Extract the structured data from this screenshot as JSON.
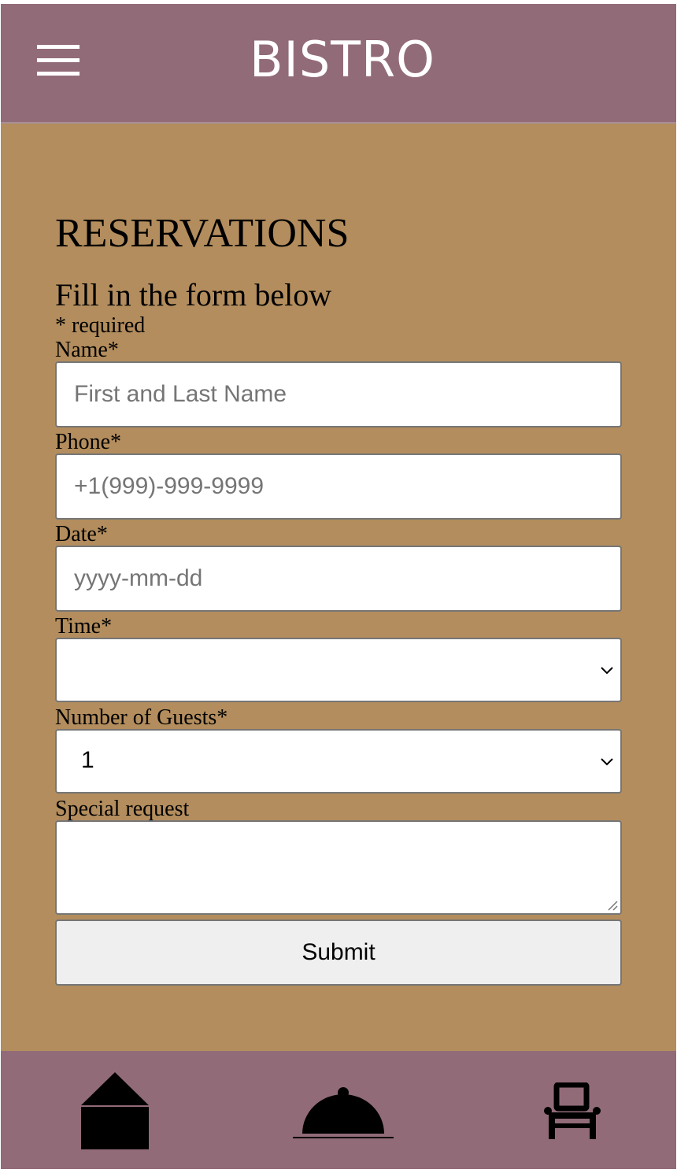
{
  "header": {
    "brand": "BISTRO",
    "menu_icon": "hamburger-menu-icon"
  },
  "form": {
    "title": "RESERVATIONS",
    "subtitle": "Fill in the form below",
    "required_note": "* required",
    "name": {
      "label": "Name*",
      "placeholder": "First and Last Name",
      "value": ""
    },
    "phone": {
      "label": "Phone*",
      "placeholder": "+1(999)-999-9999",
      "value": ""
    },
    "date": {
      "label": "Date*",
      "placeholder": "yyyy-mm-dd",
      "value": ""
    },
    "time": {
      "label": "Time*",
      "selected": ""
    },
    "guests": {
      "label": "Number of Guests*",
      "selected": "1"
    },
    "special_request": {
      "label": "Special request",
      "value": ""
    },
    "submit_label": "Submit"
  },
  "bottom_nav": {
    "items": [
      {
        "icon": "home-icon"
      },
      {
        "icon": "food-cloche-icon"
      },
      {
        "icon": "chair-reservation-icon"
      }
    ]
  },
  "colors": {
    "header_footer": "#926b79",
    "content_background": "#b38d5d",
    "input_background": "#ffffff",
    "button_background": "#efefef",
    "text": "#000000"
  }
}
